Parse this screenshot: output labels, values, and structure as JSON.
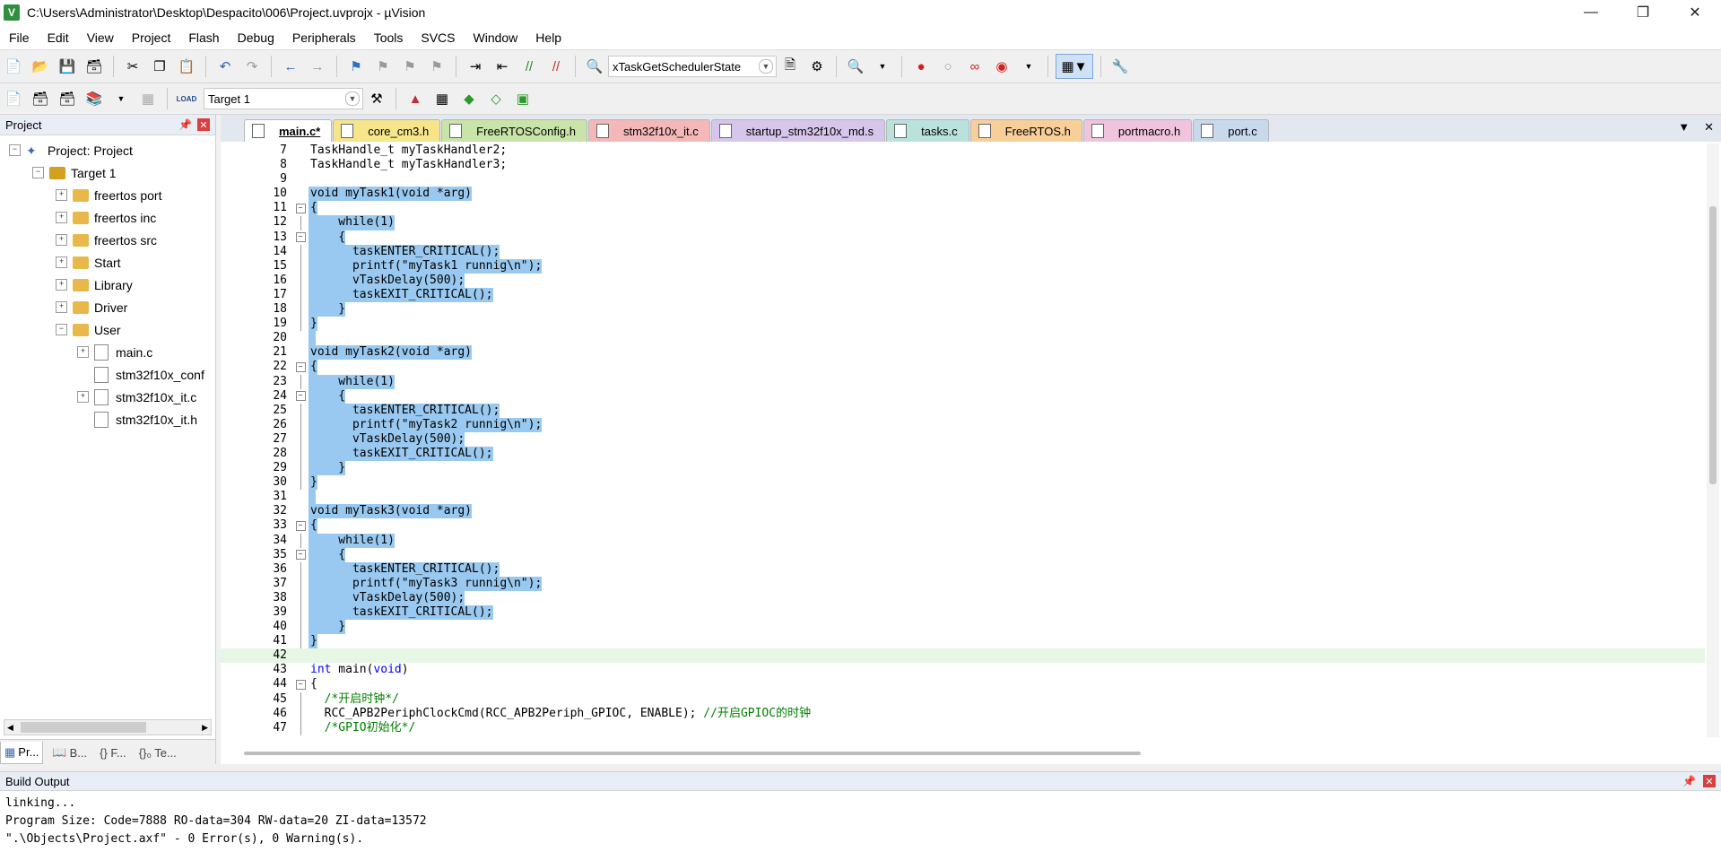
{
  "window": {
    "title": "C:\\Users\\Administrator\\Desktop\\Despacito\\006\\Project.uvprojx - µVision",
    "app_icon": "uvision-icon",
    "controls": [
      "minimize",
      "restore",
      "close"
    ]
  },
  "menu": [
    "File",
    "Edit",
    "View",
    "Project",
    "Flash",
    "Debug",
    "Peripherals",
    "Tools",
    "SVCS",
    "Window",
    "Help"
  ],
  "toolbar": {
    "function_combo": "xTaskGetSchedulerState",
    "target_combo": "Target 1",
    "load_label": "LOAD"
  },
  "project_panel": {
    "title": "Project",
    "tree": [
      {
        "label": "Project: Project",
        "level": 0,
        "type": "project",
        "expander": "−"
      },
      {
        "label": "Target 1",
        "level": 1,
        "type": "target",
        "expander": "−"
      },
      {
        "label": "freertos port",
        "level": 2,
        "type": "folder",
        "expander": "+"
      },
      {
        "label": "freertos inc",
        "level": 2,
        "type": "folder",
        "expander": "+"
      },
      {
        "label": "freertos src",
        "level": 2,
        "type": "folder",
        "expander": "+"
      },
      {
        "label": "Start",
        "level": 2,
        "type": "folder",
        "expander": "+"
      },
      {
        "label": "Library",
        "level": 2,
        "type": "folder",
        "expander": "+"
      },
      {
        "label": "Driver",
        "level": 2,
        "type": "folder",
        "expander": "+"
      },
      {
        "label": "User",
        "level": 2,
        "type": "folder",
        "expander": "−"
      },
      {
        "label": "main.c",
        "level": 3,
        "type": "file",
        "expander": "+"
      },
      {
        "label": "stm32f10x_conf",
        "level": 3,
        "type": "file",
        "expander": ""
      },
      {
        "label": "stm32f10x_it.c",
        "level": 3,
        "type": "file",
        "expander": "+"
      },
      {
        "label": "stm32f10x_it.h",
        "level": 3,
        "type": "file",
        "expander": ""
      }
    ],
    "bottom_tabs": [
      "Pr...",
      "B...",
      "{} F...",
      "{}₀ Te..."
    ]
  },
  "editor": {
    "tabs": [
      {
        "label": "main.c*",
        "color": "#ffffff",
        "active": true
      },
      {
        "label": "core_cm3.h",
        "color": "#f6e58a",
        "active": false
      },
      {
        "label": "FreeRTOSConfig.h",
        "color": "#c9e4a8",
        "active": false
      },
      {
        "label": "stm32f10x_it.c",
        "color": "#f4b8b8",
        "active": false
      },
      {
        "label": "startup_stm32f10x_md.s",
        "color": "#d7c6ec",
        "active": false
      },
      {
        "label": "tasks.c",
        "color": "#b9e2dc",
        "active": false
      },
      {
        "label": "FreeRTOS.h",
        "color": "#f9cf99",
        "active": false
      },
      {
        "label": "portmacro.h",
        "color": "#f0c4dc",
        "active": false
      },
      {
        "label": "port.c",
        "color": "#c9d9ec",
        "active": false
      }
    ],
    "lines": [
      {
        "n": "7",
        "text": "TaskHandle_t myTaskHandler2;",
        "sel": false,
        "fold": ""
      },
      {
        "n": "8",
        "text": "TaskHandle_t myTaskHandler3;",
        "sel": false,
        "fold": ""
      },
      {
        "n": "9",
        "text": "",
        "sel": false,
        "fold": ""
      },
      {
        "n": "10",
        "text": "void myTask1(void *arg)",
        "sel": true,
        "fold": ""
      },
      {
        "n": "11",
        "text": "{",
        "sel": true,
        "fold": "box"
      },
      {
        "n": "12",
        "text": "    while(1)",
        "sel": true,
        "fold": "line"
      },
      {
        "n": "13",
        "text": "    {",
        "sel": true,
        "fold": "box"
      },
      {
        "n": "14",
        "text": "      taskENTER_CRITICAL();",
        "sel": true,
        "fold": "line"
      },
      {
        "n": "15",
        "text": "      printf(\"myTask1 runnig\\n\");",
        "sel": true,
        "fold": "line"
      },
      {
        "n": "16",
        "text": "      vTaskDelay(500);",
        "sel": true,
        "fold": "line"
      },
      {
        "n": "17",
        "text": "      taskEXIT_CRITICAL();",
        "sel": true,
        "fold": "line"
      },
      {
        "n": "18",
        "text": "    }",
        "sel": true,
        "fold": "line"
      },
      {
        "n": "19",
        "text": "}",
        "sel": true,
        "fold": "line"
      },
      {
        "n": "20",
        "text": "",
        "sel": true,
        "fold": ""
      },
      {
        "n": "21",
        "text": "void myTask2(void *arg)",
        "sel": true,
        "fold": ""
      },
      {
        "n": "22",
        "text": "{",
        "sel": true,
        "fold": "box"
      },
      {
        "n": "23",
        "text": "    while(1)",
        "sel": true,
        "fold": "line"
      },
      {
        "n": "24",
        "text": "    {",
        "sel": true,
        "fold": "box"
      },
      {
        "n": "25",
        "text": "      taskENTER_CRITICAL();",
        "sel": true,
        "fold": "line"
      },
      {
        "n": "26",
        "text": "      printf(\"myTask2 runnig\\n\");",
        "sel": true,
        "fold": "line"
      },
      {
        "n": "27",
        "text": "      vTaskDelay(500);",
        "sel": true,
        "fold": "line"
      },
      {
        "n": "28",
        "text": "      taskEXIT_CRITICAL();",
        "sel": true,
        "fold": "line"
      },
      {
        "n": "29",
        "text": "    }",
        "sel": true,
        "fold": "line"
      },
      {
        "n": "30",
        "text": "}",
        "sel": true,
        "fold": "line"
      },
      {
        "n": "31",
        "text": "",
        "sel": true,
        "fold": ""
      },
      {
        "n": "32",
        "text": "void myTask3(void *arg)",
        "sel": true,
        "fold": ""
      },
      {
        "n": "33",
        "text": "{",
        "sel": true,
        "fold": "box"
      },
      {
        "n": "34",
        "text": "    while(1)",
        "sel": true,
        "fold": "line"
      },
      {
        "n": "35",
        "text": "    {",
        "sel": true,
        "fold": "box"
      },
      {
        "n": "36",
        "text": "      taskENTER_CRITICAL();",
        "sel": true,
        "fold": "line"
      },
      {
        "n": "37",
        "text": "      printf(\"myTask3 runnig\\n\");",
        "sel": true,
        "fold": "line"
      },
      {
        "n": "38",
        "text": "      vTaskDelay(500);",
        "sel": true,
        "fold": "line"
      },
      {
        "n": "39",
        "text": "      taskEXIT_CRITICAL();",
        "sel": true,
        "fold": "line"
      },
      {
        "n": "40",
        "text": "    }",
        "sel": true,
        "fold": "line"
      },
      {
        "n": "41",
        "text": "}",
        "sel": true,
        "fold": "line"
      },
      {
        "n": "42",
        "text": "",
        "sel": false,
        "fold": "",
        "current": true
      },
      {
        "n": "43",
        "text": "int main(void)",
        "sel": false,
        "fold": ""
      },
      {
        "n": "44",
        "text": "{",
        "sel": false,
        "fold": "box"
      },
      {
        "n": "45",
        "text": "  /*开启时钟*/",
        "sel": false,
        "fold": "line"
      },
      {
        "n": "46",
        "text": "  RCC_APB2PeriphClockCmd(RCC_APB2Periph_GPIOC, ENABLE); //开启GPIOC的时钟",
        "sel": false,
        "fold": "line"
      },
      {
        "n": "47",
        "text": "  /*GPIO初始化*/",
        "sel": false,
        "fold": "line"
      }
    ]
  },
  "build_output": {
    "title": "Build Output",
    "lines": [
      "linking...",
      "Program Size: Code=7888 RO-data=304 RW-data=20 ZI-data=13572",
      "\".\\Objects\\Project.axf\" - 0 Error(s), 0 Warning(s)."
    ]
  }
}
